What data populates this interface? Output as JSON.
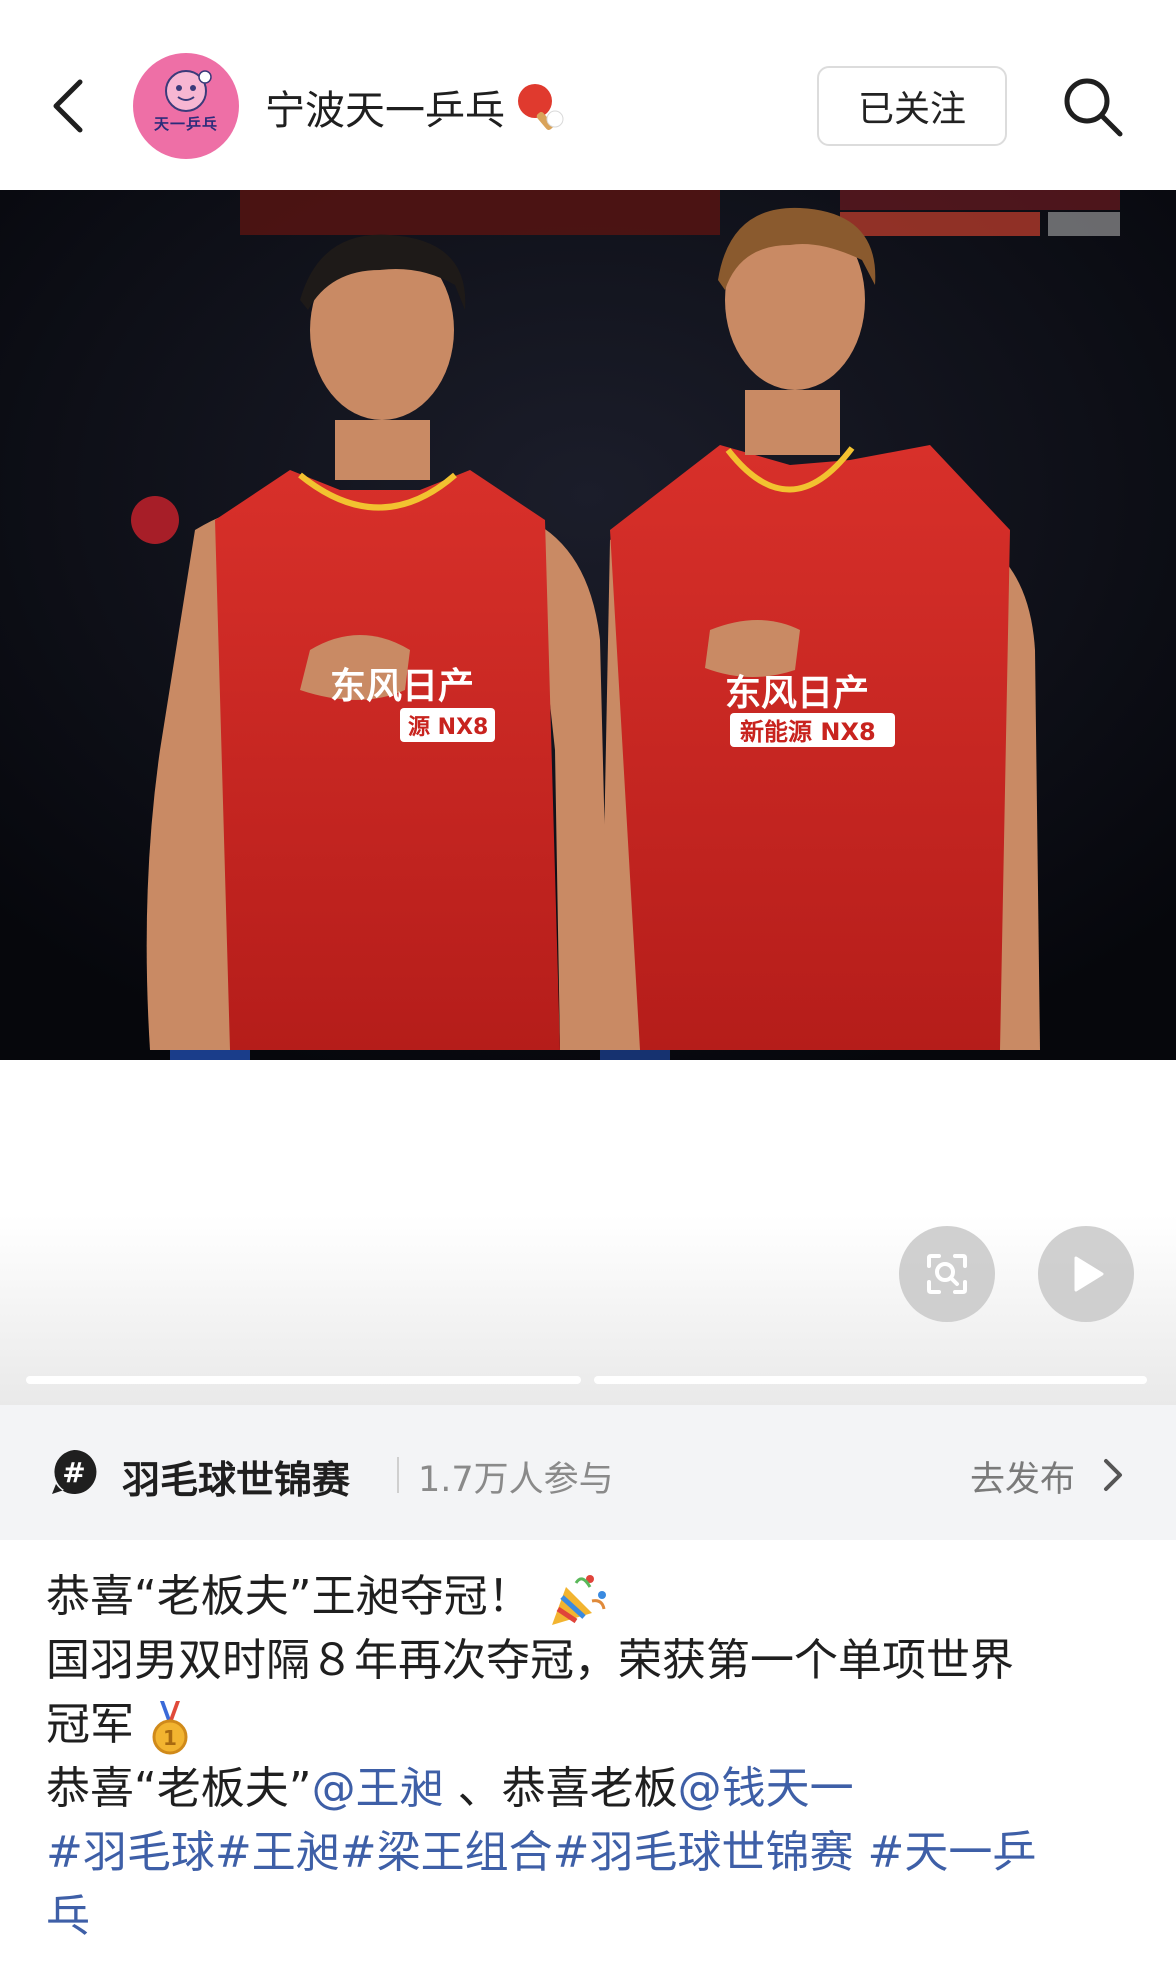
{
  "header": {
    "account_name": "宁波天一乒乓",
    "avatar_text": "天一乒乓",
    "follow_label": "已关注"
  },
  "topic": {
    "name": "羽毛球世锦赛",
    "participants": "1.7万人参与",
    "go_publish": "去发布"
  },
  "post": {
    "line1": "恭喜“老板夫”王昶夺冠！",
    "line2": "国羽男双时隔８年再次夺冠，荣获第一个单项世界",
    "line3": "冠军",
    "line4_prefix": "恭喜“老板夫”",
    "mention_1": "@王昶",
    "line4_mid": " 、恭喜老板",
    "mention_2": "@钱天一",
    "hashtags_1": "#羽毛球#王昶#梁王组合#羽毛球世锦赛 #天一乒",
    "hashtags_2": "乓"
  },
  "photo": {
    "jersey_sponsor": "东风日产",
    "jersey_model": "新能源 NX8"
  },
  "colors": {
    "link": "#3e5fa7",
    "avatar_bg": "#ee6fa6",
    "jersey_red": "#c8231e"
  },
  "icons": [
    "chevron-left-icon",
    "ping-pong-paddle-icon",
    "search-icon",
    "image-search-icon",
    "play-icon",
    "hashtag-icon",
    "chevron-right-icon",
    "party-popper-icon",
    "gold-medal-icon"
  ],
  "media_progress": {
    "segments": 2,
    "current": 1
  }
}
